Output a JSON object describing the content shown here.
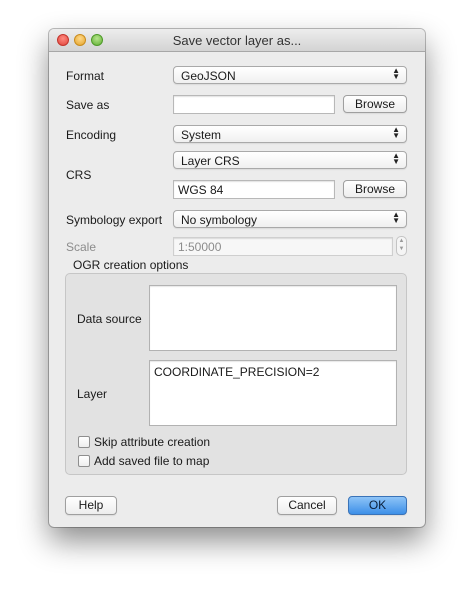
{
  "window": {
    "title": "Save vector layer as..."
  },
  "form": {
    "format_label": "Format",
    "format_value": "GeoJSON",
    "save_as_label": "Save as",
    "save_as_value": "",
    "browse_label": "Browse",
    "encoding_label": "Encoding",
    "encoding_value": "System",
    "crs_label": "CRS",
    "crs_combo_value": "Layer CRS",
    "crs_field_value": "WGS 84",
    "crs_browse_label": "Browse",
    "symbology_label": "Symbology export",
    "symbology_value": "No symbology",
    "scale_label": "Scale",
    "scale_value": "1:50000"
  },
  "ogr": {
    "group_title": "OGR creation options",
    "data_source_label": "Data source",
    "data_source_value": "",
    "layer_label": "Layer",
    "layer_value": "COORDINATE_PRECISION=2",
    "skip_attr_label": "Skip attribute creation",
    "skip_attr_checked": false,
    "add_to_map_label": "Add saved file to map",
    "add_to_map_checked": false
  },
  "buttons": {
    "help": "Help",
    "cancel": "Cancel",
    "ok": "OK"
  },
  "icons": {
    "combo_arrows": "up-down-chevron-icon",
    "traffic_lights": [
      "close-icon",
      "minimize-icon",
      "zoom-icon"
    ]
  },
  "colors": {
    "accent": "#3d8fe8",
    "window_bg": "#ececec"
  }
}
